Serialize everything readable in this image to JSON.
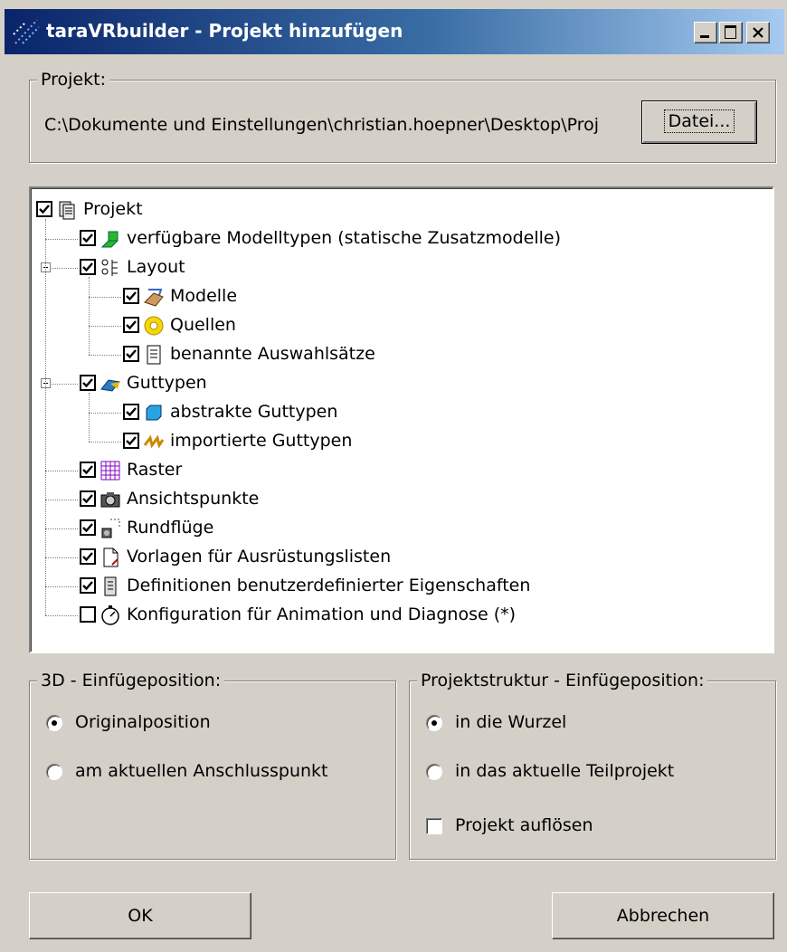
{
  "window": {
    "title": "taraVRbuilder - Projekt hinzufügen"
  },
  "project": {
    "group_label": "Projekt:",
    "path": "C:\\Dokumente und Einstellungen\\christian.hoepner\\Desktop\\Proj",
    "file_button": "Datei..."
  },
  "tree": {
    "items": [
      {
        "label": "Projekt",
        "checked": true,
        "icon": "project-icon"
      },
      {
        "label": "verfügbare Modelltypen (statische Zusatzmodelle)",
        "checked": true,
        "icon": "model-types-icon"
      },
      {
        "label": "Layout",
        "checked": true,
        "icon": "layout-icon",
        "expanded": true
      },
      {
        "label": "Modelle",
        "checked": true,
        "icon": "models-icon"
      },
      {
        "label": "Quellen",
        "checked": true,
        "icon": "sources-icon"
      },
      {
        "label": "benannte Auswahlsätze",
        "checked": true,
        "icon": "selection-sets-icon"
      },
      {
        "label": "Guttypen",
        "checked": true,
        "icon": "goods-types-icon",
        "expanded": true
      },
      {
        "label": "abstrakte Guttypen",
        "checked": true,
        "icon": "abstract-goods-icon"
      },
      {
        "label": "importierte Guttypen",
        "checked": true,
        "icon": "imported-goods-icon"
      },
      {
        "label": "Raster",
        "checked": true,
        "icon": "grid-icon"
      },
      {
        "label": "Ansichtspunkte",
        "checked": true,
        "icon": "camera-icon"
      },
      {
        "label": "Rundflüge",
        "checked": true,
        "icon": "flyover-icon"
      },
      {
        "label": "Vorlagen für Ausrüstungslisten",
        "checked": true,
        "icon": "document-icon"
      },
      {
        "label": "Definitionen benutzerdefinierter Eigenschaften",
        "checked": true,
        "icon": "info-icon"
      },
      {
        "label": "Konfiguration für Animation und Diagnose (*)",
        "checked": false,
        "icon": "stopwatch-icon"
      }
    ]
  },
  "position3d": {
    "group_label": "3D - Einfügeposition:",
    "options": [
      {
        "label": "Originalposition",
        "selected": true
      },
      {
        "label": "am aktuellen Anschlusspunkt",
        "selected": false
      }
    ]
  },
  "structure": {
    "group_label": "Projektstruktur - Einfügeposition:",
    "options": [
      {
        "label": "in die Wurzel",
        "selected": true
      },
      {
        "label": "in das aktuelle Teilprojekt",
        "selected": false
      }
    ],
    "dissolve_label": "Projekt auflösen",
    "dissolve_checked": false
  },
  "buttons": {
    "ok": "OK",
    "cancel": "Abbrechen"
  },
  "colors": {
    "title_start": "#0a246a",
    "title_end": "#a6caf0",
    "face": "#d4d0c8"
  }
}
